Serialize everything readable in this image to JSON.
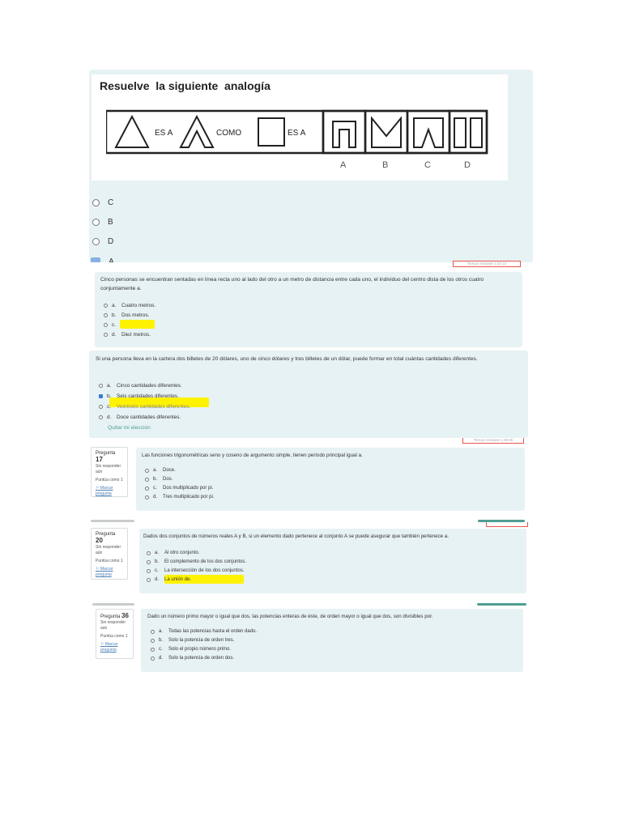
{
  "q1": {
    "title": "Resuelve  la siguiente  analogía",
    "es_a_1": "ES A",
    "como": "COMO",
    "es_a_2": "ES A",
    "choices": [
      "A",
      "B",
      "C",
      "D"
    ],
    "options": [
      "C",
      "B",
      "D",
      "A"
    ]
  },
  "q2": {
    "timer": "Tiempo restante 1:02:10",
    "text": "Cinco personas se encuentran sentadas en línea recta uno al lado del otro a un metro de distancia entre cada uno, el individuo del centro dista de los otros cuatro conjuntamente a.",
    "options": [
      {
        "letter": "a.",
        "label": "Cuatro metros."
      },
      {
        "letter": "b.",
        "label": "Dos metros."
      },
      {
        "letter": "c.",
        "label": ""
      },
      {
        "letter": "d.",
        "label": "Diez metros."
      }
    ]
  },
  "q3": {
    "text": "Si una persona lleva en la cartera dos billetes de 20 dólares, uno de cinco dólares y tres billetes de un dólar, puede formar en total cuántas cantidades diferentes.",
    "options": [
      {
        "letter": "a.",
        "label": "Cinco cantidades diferentes."
      },
      {
        "letter": "b.",
        "label": "Seis cantidades diferentes."
      },
      {
        "letter": "c.",
        "label": "Veintiséis cantidades diferentes."
      },
      {
        "letter": "d.",
        "label": "Doce cantidades diferentes."
      }
    ],
    "selected": 1,
    "clear_label": "Quitar mi elección",
    "timer": "Tiempo restante 1:46:05"
  },
  "q17": {
    "pregunta": "Pregunta",
    "number": "17",
    "status": "Sin responder aún",
    "score": "Puntúa como 1",
    "flag": "Marcar pregunta",
    "text": "Las funciones trigonométricas seno y coseno de argumento simple, tienen período principal igual a.",
    "options": [
      {
        "letter": "a.",
        "label": "Doce."
      },
      {
        "letter": "b.",
        "label": "Dos."
      },
      {
        "letter": "c.",
        "label": "Dos multiplicado por pi."
      },
      {
        "letter": "d.",
        "label": "Tres multiplicado por pi."
      }
    ]
  },
  "q20": {
    "pregunta": "Pregunta",
    "number": "20",
    "status": "Sin responder aún",
    "score": "Puntúa como 1",
    "flag": "Marcar pregunta",
    "text": "Dados dos conjuntos de números reales A y B, si un elemento dado pertenece al conjunto A se puede asegurar que también pertenece a.",
    "options": [
      {
        "letter": "a.",
        "label": "Al otro conjunto."
      },
      {
        "letter": "b.",
        "label": "El complemento de los dos conjuntos."
      },
      {
        "letter": "c.",
        "label": "La intersección de los dos conjuntos."
      },
      {
        "letter": "d.",
        "label": "La unión de."
      }
    ]
  },
  "q36": {
    "pregunta": "Pregunta",
    "number": "36",
    "status": "Sin responder aún",
    "score": "Puntúa como 1",
    "flag": "Marcar pregunta",
    "text": "Dado un número primo mayor o igual que dos, las potencias enteras de éste, de orden mayor o igual que dos, son divisibles por.",
    "options": [
      {
        "letter": "a.",
        "label": "Todas las potencias hasta el orden dado."
      },
      {
        "letter": "b.",
        "label": "Solo la potencia de orden tres."
      },
      {
        "letter": "c.",
        "label": "Solo el propio número primo."
      },
      {
        "letter": "d.",
        "label": "Solo la potencia de orden dos."
      }
    ]
  },
  "colors": {
    "panel_bg": "#e7f2f4",
    "highlight": "#fff200",
    "timer_border": "#e5544c",
    "teal": "#4f9e92",
    "link": "#4a7fb5"
  }
}
